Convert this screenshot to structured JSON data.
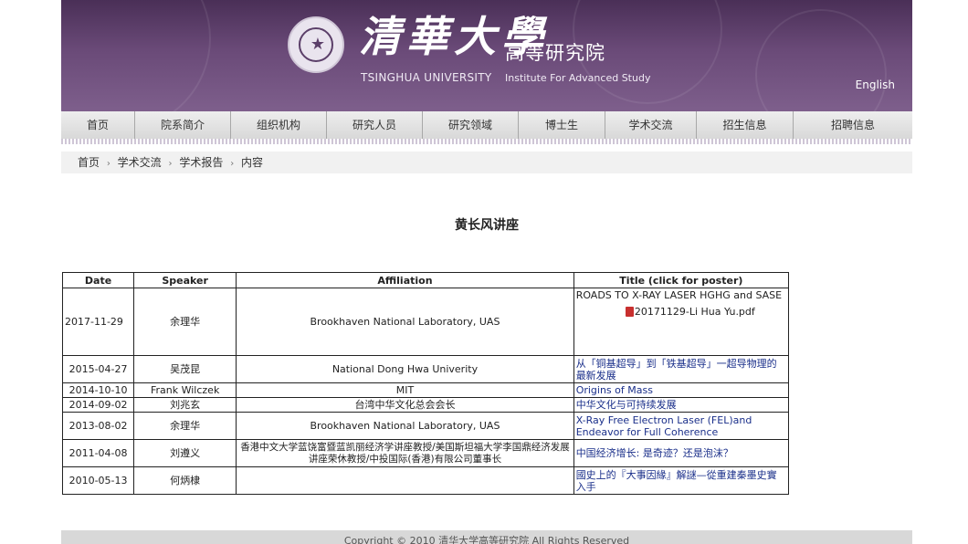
{
  "header": {
    "brand_cn": "清華大學",
    "brand_en": "TSINGHUA UNIVERSITY",
    "institute_cn": "高等研究院",
    "institute_en": "Institute For Advanced Study",
    "lang_link": "English"
  },
  "nav": {
    "items": [
      {
        "label": "首页"
      },
      {
        "label": "院系简介"
      },
      {
        "label": "组织机构"
      },
      {
        "label": "研究人员"
      },
      {
        "label": "研究领域"
      },
      {
        "label": "博士生"
      },
      {
        "label": "学术交流"
      },
      {
        "label": "招生信息"
      },
      {
        "label": "招聘信息"
      }
    ]
  },
  "breadcrumb": {
    "home": "首页",
    "sep": "›",
    "level1": "学术交流",
    "level2": "学术报告",
    "current": "内容"
  },
  "page_title": "黄长风讲座",
  "table": {
    "headers": [
      "Date",
      "Speaker",
      "Affiliation",
      "Title (click for poster)"
    ],
    "rows": [
      {
        "date": "2017-11-29",
        "speaker": "余理华",
        "affiliation": "Brookhaven National Laboratory, UAS",
        "title": "ROADS TO X-RAY LASER HGHG and SASE",
        "attachment": "20171129-Li Hua Yu.pdf"
      },
      {
        "date": "2015-04-27",
        "speaker": "吴茂昆",
        "affiliation": "National Dong Hwa Univerity",
        "title": "从「铜基超导」到「铁基超导」一超导物理的最新发展"
      },
      {
        "date": "2014-10-10",
        "speaker": "Frank Wilczek",
        "affiliation": "MIT",
        "title": "Origins of Mass"
      },
      {
        "date": "2014-09-02",
        "speaker": "刘兆玄",
        "affiliation": "台湾中华文化总会会长",
        "title": "中华文化与可持续发展"
      },
      {
        "date": "2013-08-02",
        "speaker": "余理华",
        "affiliation": "Brookhaven National Laboratory, UAS",
        "title": "X-Ray Free Electron Laser (FEL)and Endeavor for Full Coherence"
      },
      {
        "date": "2011-04-08",
        "speaker": "刘遵义",
        "affiliation": "香港中文大学蓝饶富暨蓝凯丽经济学讲座教授/美国斯坦福大学李国鼎经济发展讲座荣休教授/中投国际(香港)有限公司董事长",
        "title": "中国经济增长: 是奇迹？还是泡沫？"
      },
      {
        "date": "2010-05-13",
        "speaker": "何炳棣",
        "affiliation": "",
        "title": "國史上的『大事因緣』解謎—從重建秦墨史實入手"
      }
    ]
  },
  "footer": {
    "text": "Copyright © 2010 清华大学高等研究院 All Rights Reserved"
  }
}
